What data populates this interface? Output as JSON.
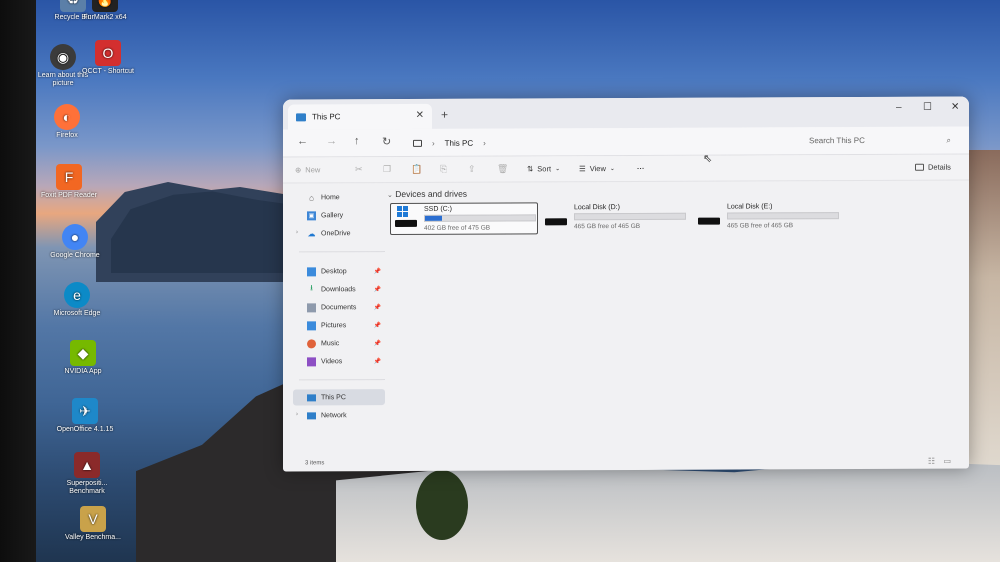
{
  "desktop": {
    "icons": [
      {
        "label": "Recycle Bin",
        "icon": "recycle-bin-icon",
        "color": "#5b7fa8"
      },
      {
        "label": "FurMark2 x64",
        "icon": "furmark-icon",
        "color": "#222222"
      },
      {
        "label": "Learn about this picture",
        "icon": "camera-icon",
        "color": "#3b3b3b"
      },
      {
        "label": "OCCT - Shortcut",
        "icon": "occt-icon",
        "color": "#d32f2f"
      },
      {
        "label": "Firefox",
        "icon": "firefox-icon",
        "color": "#ff7139"
      },
      {
        "label": "Foxit PDF Reader",
        "icon": "foxit-icon",
        "color": "#f26722"
      },
      {
        "label": "Google Chrome",
        "icon": "chrome-icon",
        "color": "#4285f4"
      },
      {
        "label": "Microsoft Edge",
        "icon": "edge-icon",
        "color": "#0c8ac7"
      },
      {
        "label": "NVIDIA App",
        "icon": "nvidia-icon",
        "color": "#76b900"
      },
      {
        "label": "OpenOffice 4.1.15",
        "icon": "openoffice-icon",
        "color": "#1e88c9"
      },
      {
        "label": "Superpositi... Benchmark",
        "icon": "superposition-icon",
        "color": "#8b2a2a"
      },
      {
        "label": "Valley Benchma...",
        "icon": "valley-icon",
        "color": "#c9a24a"
      }
    ]
  },
  "window": {
    "tab_title": "This PC",
    "new_tab": "+",
    "controls": {
      "minimize": "–",
      "maximize": "☐",
      "close": "✕"
    },
    "address": {
      "location": "This PC"
    },
    "search_placeholder": "Search This PC",
    "commands": {
      "new": "New",
      "sort": "Sort",
      "view": "View",
      "more": "···",
      "details": "Details"
    },
    "sidebar": {
      "top": [
        {
          "label": "Home",
          "icon": "home-icon"
        },
        {
          "label": "Gallery",
          "icon": "gallery-icon"
        },
        {
          "label": "OneDrive",
          "icon": "onedrive-icon"
        }
      ],
      "quick_access": [
        {
          "label": "Desktop",
          "icon": "desktop-folder-icon"
        },
        {
          "label": "Downloads",
          "icon": "downloads-icon"
        },
        {
          "label": "Documents",
          "icon": "documents-icon"
        },
        {
          "label": "Pictures",
          "icon": "pictures-icon"
        },
        {
          "label": "Music",
          "icon": "music-icon"
        },
        {
          "label": "Videos",
          "icon": "videos-icon"
        }
      ],
      "locations": [
        {
          "label": "This PC",
          "icon": "computer-icon",
          "selected": true
        },
        {
          "label": "Network",
          "icon": "network-icon",
          "selected": false
        }
      ]
    },
    "section_title": "Devices and drives",
    "drives": [
      {
        "name": "SSD (C:)",
        "free_text": "402 GB free of 475 GB",
        "used_fraction": 0.15,
        "selected": true
      },
      {
        "name": "Local Disk (D:)",
        "free_text": "465 GB free of 465 GB",
        "used_fraction": 0.0,
        "selected": false
      },
      {
        "name": "Local Disk (E:)",
        "free_text": "465 GB free of 465 GB",
        "used_fraction": 0.0,
        "selected": false
      }
    ],
    "status": "3 items"
  }
}
